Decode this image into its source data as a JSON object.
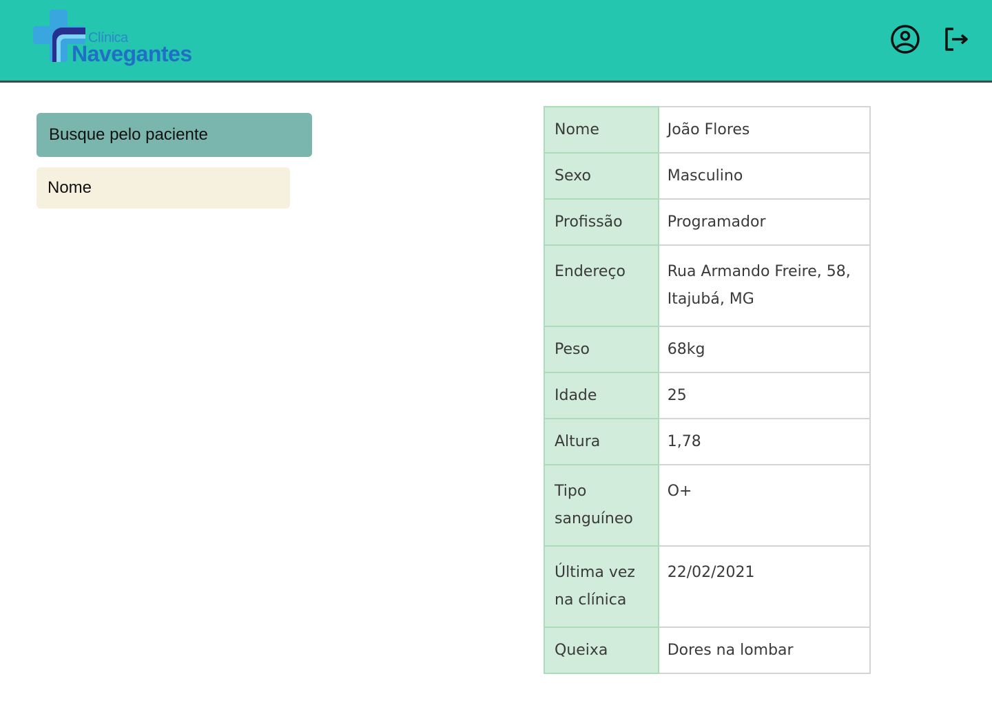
{
  "header": {
    "logo_small": "Clínica",
    "logo_big": "Navegantes"
  },
  "search": {
    "title": "Busque pelo paciente",
    "placeholder": "Nome"
  },
  "patient": [
    {
      "label": "Nome",
      "value": "João Flores"
    },
    {
      "label": "Sexo",
      "value": "Masculino"
    },
    {
      "label": "Profissão",
      "value": "Programador"
    },
    {
      "label": "Endereço",
      "value": "Rua Armando Freire, 58, Itajubá, MG"
    },
    {
      "label": "Peso",
      "value": "68kg"
    },
    {
      "label": "Idade",
      "value": "25"
    },
    {
      "label": "Altura",
      "value": "1,78"
    },
    {
      "label": "Tipo sanguíneo",
      "value": "O+"
    },
    {
      "label": "Última vez na clínica",
      "value": "22/02/2021"
    },
    {
      "label": "Queixa",
      "value": "Dores na lombar"
    }
  ],
  "colors": {
    "header_bg": "#24c6b0",
    "search_title_bg": "#7bb6ae",
    "search_input_bg": "#f6f1df",
    "label_cell_bg": "#d1ecda"
  }
}
